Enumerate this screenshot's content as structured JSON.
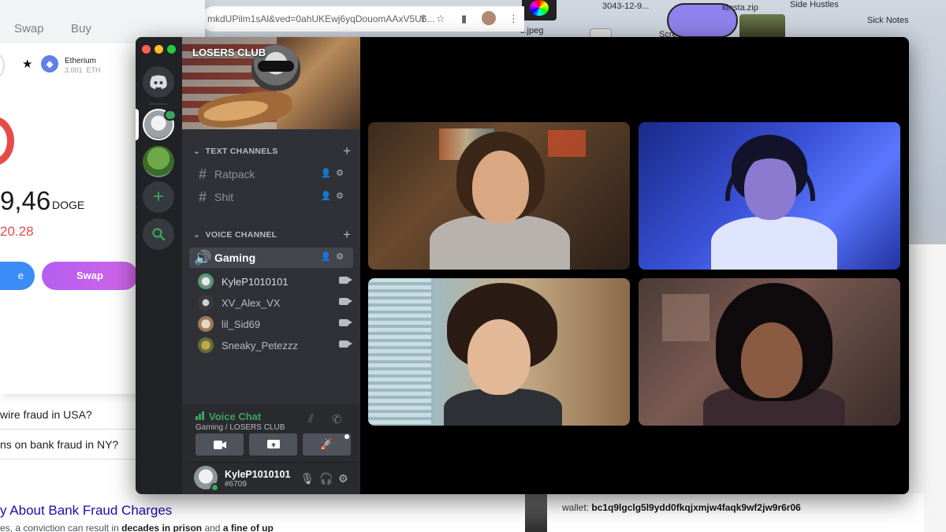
{
  "desktop": {
    "labels": [
      {
        "text": "3043-12-9..."
      },
      {
        "text": "kinsta.zip"
      },
      {
        "text": "Side Hustles"
      },
      {
        "text": "Sick Notes"
      },
      {
        "text": "Screenshot"
      },
      {
        "text": "s.jpeg"
      }
    ]
  },
  "browser": {
    "url": "mkdUPilm1sAl&ved=0ahUKEwj6yqDouomAAxV5U6..."
  },
  "wallet_popup": {
    "tabs": [
      "Swap",
      "Buy"
    ],
    "asset_name": "Etherium",
    "asset_balance": "3.001",
    "asset_unit": "ETH",
    "balance": "9,46",
    "balance_unit": "DOGE",
    "delta": "20.28",
    "left_button": "e",
    "swap_button": "Swap"
  },
  "search": {
    "line1": "wire fraud in USA?",
    "line2": "ns on bank fraud in NY?",
    "result_title": "y About Bank Fraud Charges",
    "snippet_pre": "es, a conviction can result in ",
    "snippet_bold1": "decades in prison",
    "snippet_mid": " and ",
    "snippet_bold2": "a fine of up"
  },
  "wallet_page": {
    "label": "wallet:",
    "address": "bc1q9lgclg5l9ydd0fkqjxmjw4faqk9wf2jw9r6r06"
  },
  "discord": {
    "server_name": "LOSERS CLUB",
    "text_category": "TEXT CHANNELS",
    "text_channels": [
      {
        "name": "Ratpack"
      },
      {
        "name": "Shit"
      }
    ],
    "voice_category": "VOICE CHANNEL",
    "voice_channel": "Gaming",
    "voice_users": [
      {
        "name": "KyleP1010101",
        "speaking": true
      },
      {
        "name": "XV_Alex_VX",
        "speaking": false
      },
      {
        "name": "lil_Sid69",
        "speaking": false
      },
      {
        "name": "Sneaky_Petezzz",
        "speaking": false
      }
    ],
    "voice_panel": {
      "title": "Voice Chat",
      "subtitle": "Gaming / LOSERS CLUB"
    },
    "user": {
      "name": "KyleP1010101",
      "tag": "#6709"
    }
  },
  "colors": {
    "discord_green": "#3ba55d",
    "discord_dark": "#202225",
    "channel_bg": "#2f3136",
    "swap_purple": "#c060ec",
    "negative_red": "#e84a4a"
  },
  "icons": {
    "rail": [
      "discord-logo-icon",
      "add-server-icon",
      "explore-icon"
    ],
    "voice_controls": [
      "camera-icon",
      "screen-share-icon",
      "activity-rocket-icon"
    ],
    "user_controls": [
      "microphone-icon",
      "headphones-icon",
      "settings-gear-icon"
    ]
  }
}
